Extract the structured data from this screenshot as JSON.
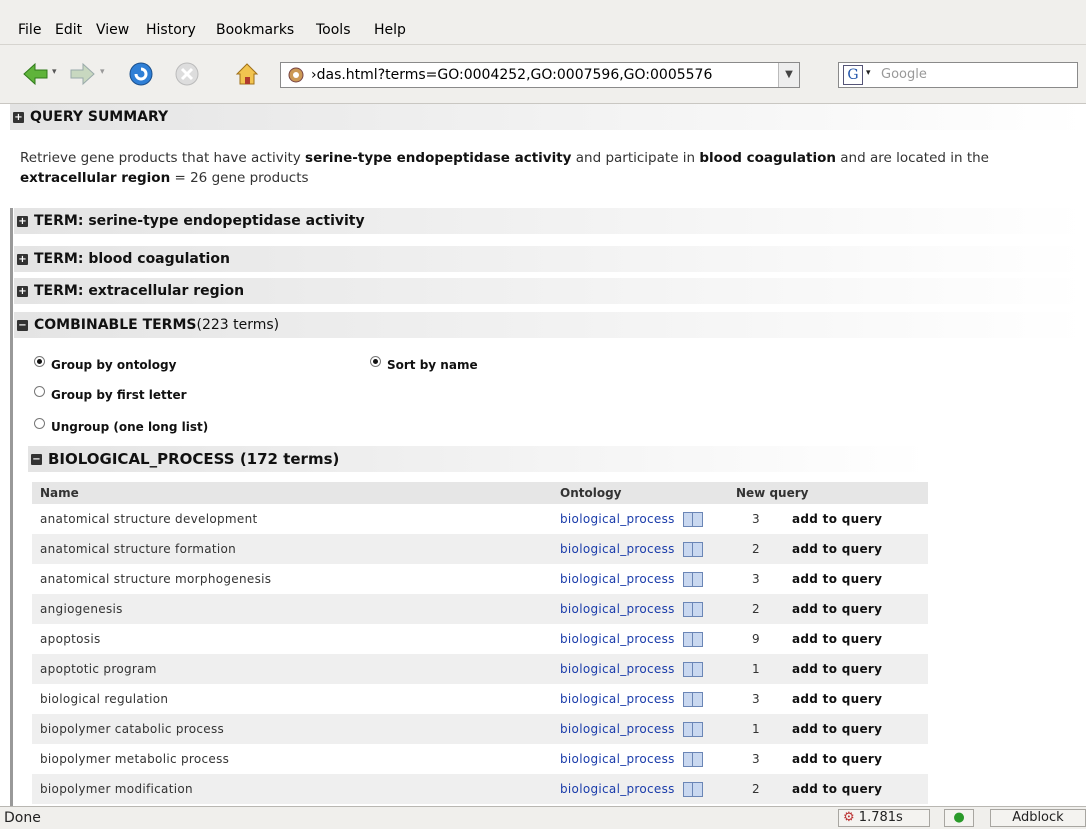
{
  "menu": {
    "file": "File",
    "edit": "Edit",
    "view": "View",
    "history": "History",
    "bookmarks": "Bookmarks",
    "tools": "Tools",
    "help": "Help"
  },
  "toolbar": {
    "url": "›das.html?terms=GO:0004252,GO:0007596,GO:0005576",
    "search_placeholder": "Google",
    "search_engine": "G"
  },
  "sections": {
    "query_summary": "QUERY SUMMARY",
    "summary": {
      "p1": "Retrieve gene products that have activity ",
      "t1": "serine-type endopeptidase activity",
      "p2": " and participate in ",
      "t2": "blood coagulation",
      "p3": " and are located in the ",
      "t3": "extracellular region",
      "p4": " = 26 gene products"
    },
    "term_prefix": "TERM:",
    "term1": "serine-type endopeptidase activity",
    "term2": "blood coagulation",
    "term3": "extracellular region",
    "combinable": "COMBINABLE TERMS",
    "combinable_count": "(223 terms)",
    "bio_process": "BIOLOGICAL_PROCESS (172 terms)"
  },
  "options": {
    "group_ontology": "Group by ontology",
    "group_letter": "Group by first letter",
    "ungroup": "Ungroup (one long list)",
    "sort_name": "Sort by name"
  },
  "table": {
    "headers": {
      "name": "Name",
      "ontology": "Ontology",
      "new_query": "New query"
    },
    "rows": [
      {
        "name": "anatomical structure development",
        "ontology": "biological_process",
        "count": "3",
        "action": "add to query"
      },
      {
        "name": "anatomical structure formation",
        "ontology": "biological_process",
        "count": "2",
        "action": "add to query"
      },
      {
        "name": "anatomical structure morphogenesis",
        "ontology": "biological_process",
        "count": "3",
        "action": "add to query"
      },
      {
        "name": "angiogenesis",
        "ontology": "biological_process",
        "count": "2",
        "action": "add to query"
      },
      {
        "name": "apoptosis",
        "ontology": "biological_process",
        "count": "9",
        "action": "add to query"
      },
      {
        "name": "apoptotic program",
        "ontology": "biological_process",
        "count": "1",
        "action": "add to query"
      },
      {
        "name": "biological regulation",
        "ontology": "biological_process",
        "count": "3",
        "action": "add to query"
      },
      {
        "name": "biopolymer catabolic process",
        "ontology": "biological_process",
        "count": "1",
        "action": "add to query"
      },
      {
        "name": "biopolymer metabolic process",
        "ontology": "biological_process",
        "count": "3",
        "action": "add to query"
      },
      {
        "name": "biopolymer modification",
        "ontology": "biological_process",
        "count": "2",
        "action": "add to query"
      }
    ]
  },
  "status": {
    "text": "Done",
    "timing": "1.781s",
    "adblock": "Adblock"
  }
}
